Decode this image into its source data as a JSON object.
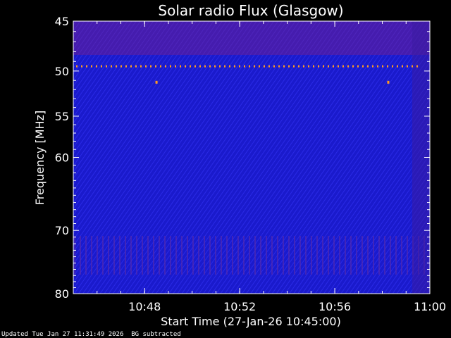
{
  "footer": {
    "updated": "Updated Tue Jan 27 11:31:49 2026",
    "note": "BG subtracted"
  },
  "colors": {
    "background": "#000000",
    "axis": "#ffffff",
    "spectrogram_base": "#1a1acc",
    "spectrogram_band": "#7a1f8a",
    "burst": "#ff9a22"
  },
  "chart_data": {
    "type": "heatmap",
    "title": "Solar radio Flux (Glasgow)",
    "xlabel": "Start Time (27-Jan-26 10:45:00)",
    "ylabel": "Frequency [MHz]",
    "x_range": [
      "10:45:00",
      "11:00:00"
    ],
    "y_range": [
      45,
      80
    ],
    "y_reversed": true,
    "x_ticks": [
      {
        "value": "10:48",
        "minute": 3
      },
      {
        "value": "10:52",
        "minute": 7
      },
      {
        "value": "10:56",
        "minute": 11
      },
      {
        "value": "11:00",
        "minute": 15
      }
    ],
    "y_ticks": [
      45,
      50,
      55,
      60,
      70,
      80
    ],
    "y_scale": "log",
    "features": [
      {
        "name": "interference line",
        "frequency_mhz": 49.5,
        "color": "#ff9a22"
      },
      {
        "name": "spot",
        "time": "10:48:30",
        "frequency_mhz": 51.2
      },
      {
        "name": "spot",
        "time": "10:58:15",
        "frequency_mhz": 51.2
      }
    ]
  }
}
